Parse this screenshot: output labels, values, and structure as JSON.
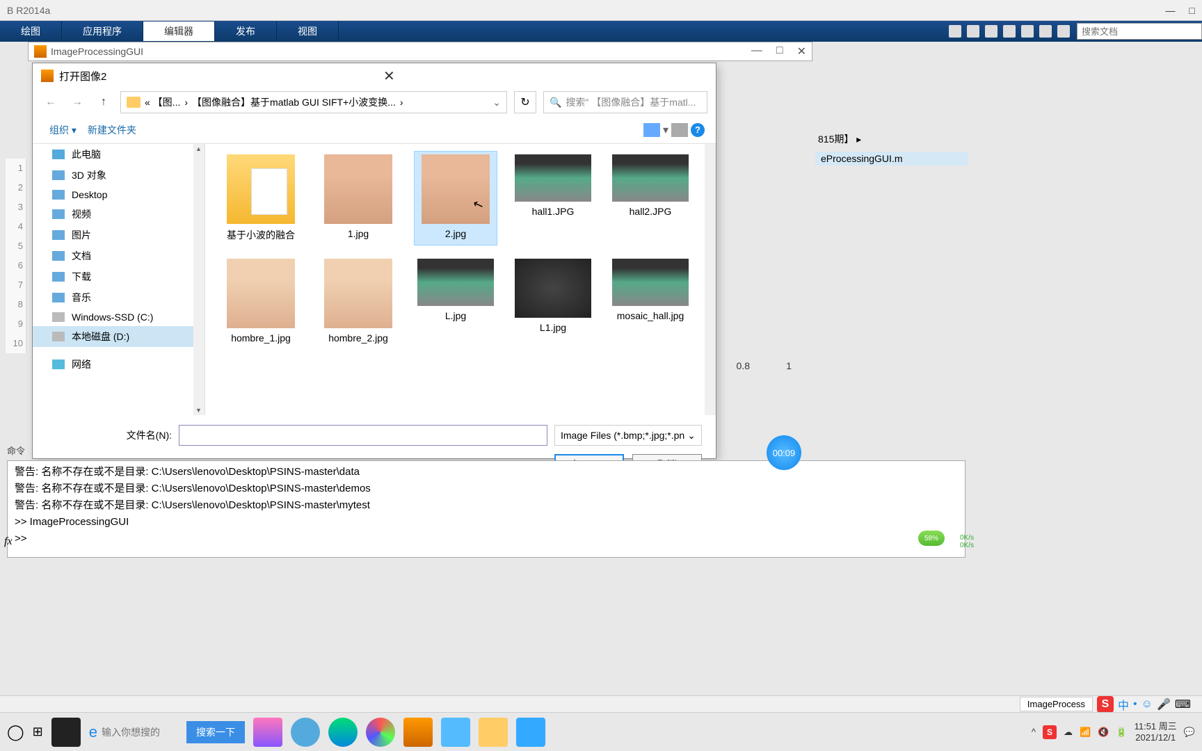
{
  "mainWindow": {
    "title": "B R2014a"
  },
  "toolstrip": {
    "tabs": [
      "绘图",
      "应用程序",
      "编辑器",
      "发布",
      "视图"
    ],
    "activeTab": 2,
    "searchPlaceholder": "搜索文档"
  },
  "guiWindow": {
    "title": "ImageProcessingGUI"
  },
  "fileDialog": {
    "title": "打开图像2",
    "breadcrumb": {
      "part1": "« 【图...",
      "part2": "【图像融合】基于matlab GUI SIFT+小波变换...",
      "sep": "›"
    },
    "searchPlaceholder": "搜索\" 【图像融合】基于matl...",
    "toolbar": {
      "organize": "组织",
      "newFolder": "新建文件夹"
    },
    "sidebar": [
      {
        "label": "此电脑",
        "icon": "pc"
      },
      {
        "label": "3D 对象",
        "icon": "3d"
      },
      {
        "label": "Desktop",
        "icon": "desk"
      },
      {
        "label": "视频",
        "icon": "video"
      },
      {
        "label": "图片",
        "icon": "pic"
      },
      {
        "label": "文档",
        "icon": "doc"
      },
      {
        "label": "下载",
        "icon": "dl"
      },
      {
        "label": "音乐",
        "icon": "music"
      },
      {
        "label": "Windows-SSD (C:)",
        "icon": "drive"
      },
      {
        "label": "本地磁盘 (D:)",
        "icon": "drive",
        "selected": true
      },
      {
        "label": "网络",
        "icon": "net"
      }
    ],
    "items": [
      {
        "name": "基于小波的融合",
        "type": "folder"
      },
      {
        "name": "1.jpg",
        "type": "face1"
      },
      {
        "name": "2.jpg",
        "type": "face1",
        "selected": true
      },
      {
        "name": "hall1.JPG",
        "type": "room"
      },
      {
        "name": "hall2.JPG",
        "type": "room"
      },
      {
        "name": "hombre_1.jpg",
        "type": "face2"
      },
      {
        "name": "hombre_2.jpg",
        "type": "face2"
      },
      {
        "name": "L.jpg",
        "type": "room"
      },
      {
        "name": "L1.jpg",
        "type": "watch"
      },
      {
        "name": "mosaic_hall.jpg",
        "type": "room"
      }
    ],
    "filenameLabel": "文件名(N):",
    "filenameValue": "",
    "filterText": "Image Files (*.bmp;*.jpg;*.pn",
    "openBtn": "打开(O)",
    "cancelBtn": "取消"
  },
  "commandWindow": {
    "label": "命令",
    "lines": [
      "警告: 名称不存在或不是目录: C:\\Users\\lenovo\\Desktop\\PSINS-master\\data",
      "警告: 名称不存在或不是目录: C:\\Users\\lenovo\\Desktop\\PSINS-master\\demos",
      "警告: 名称不存在或不是目录: C:\\Users\\lenovo\\Desktop\\PSINS-master\\mytest",
      ">> ImageProcessingGUI",
      ">>"
    ],
    "fx": "fx"
  },
  "gutterLines": [
    "1",
    "2",
    "3",
    "4",
    "5",
    "6",
    "7",
    "8",
    "9",
    "10"
  ],
  "rightPanel": {
    "path": "815期】 ▸",
    "file": "eProcessingGUI.m"
  },
  "axis": {
    "t08": "0.8",
    "t1": "1"
  },
  "recBadge": "00:09",
  "battery": "58%",
  "netSpeed": {
    "up": "0K/s",
    "down": "0K/s"
  },
  "statusbar": {
    "file": "ImageProcess"
  },
  "taskbar": {
    "searchPlaceholder": "输入你想搜的",
    "searchBtn": "搜索一下",
    "time": "11:51",
    "day": "周三",
    "date": "2021/12/1",
    "ime": "中"
  }
}
